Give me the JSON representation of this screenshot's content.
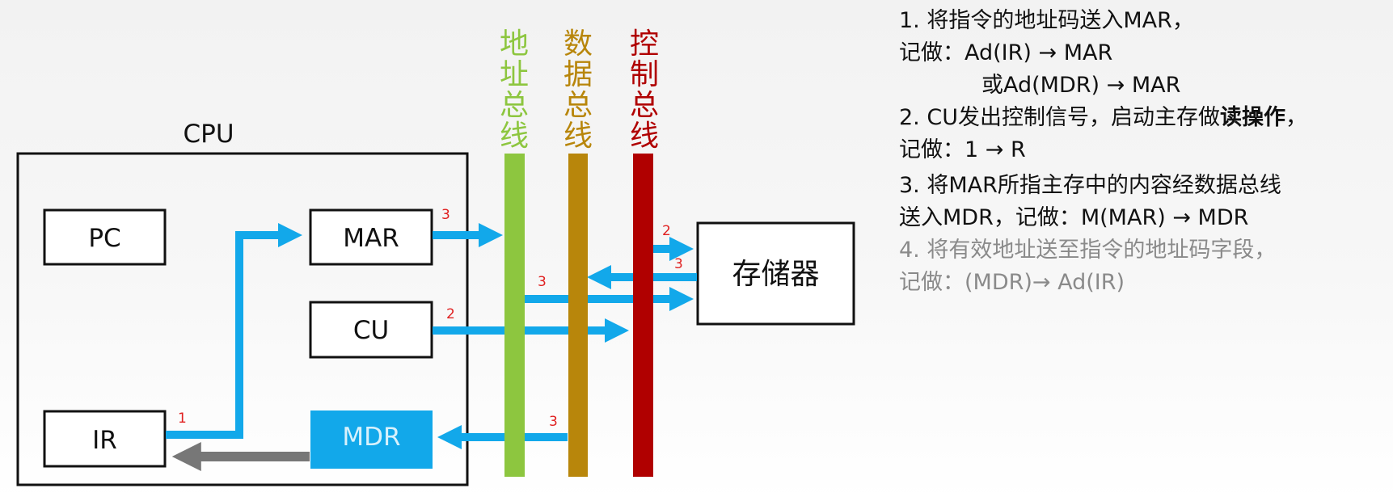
{
  "diagram": {
    "cpu_label": "CPU",
    "registers": {
      "pc": "PC",
      "mar": "MAR",
      "cu": "CU",
      "ir": "IR",
      "mdr": "MDR"
    },
    "memory_label": "存储器",
    "buses": {
      "address": {
        "label": "地址总线",
        "chars": [
          "地",
          "址",
          "总",
          "线"
        ],
        "color": "#8dc63f"
      },
      "data": {
        "label": "数据总线",
        "chars": [
          "数",
          "据",
          "总",
          "线"
        ],
        "color": "#b8860b"
      },
      "control": {
        "label": "控制总线",
        "chars": [
          "控",
          "制",
          "总",
          "线"
        ],
        "color": "#b00000"
      }
    },
    "step_marks": {
      "ir_to_mar": "1",
      "mar_to_addr_bus": "3",
      "ctrl_to_mem": "2",
      "mem_to_data_bus": "3",
      "addr_bus_to_mem": "3",
      "cu_to_ctrl_bus": "2",
      "data_bus_to_mdr": "3"
    },
    "colors": {
      "arrow": "#12a8ea",
      "mdr_fill": "#12a8ea",
      "back_arrow": "#777777",
      "step_mark": "#e02020",
      "muted_text": "#8a8a8a"
    }
  },
  "steps": [
    {
      "lines": [
        {
          "pre": "1. 将指令的地址码送入MAR，",
          "bold": "",
          "post": ""
        },
        {
          "pre": "记做：Ad(IR) → MAR",
          "bold": "",
          "post": ""
        },
        {
          "pre": "或Ad(MDR) → MAR",
          "bold": "",
          "post": ""
        }
      ]
    },
    {
      "lines": [
        {
          "pre": "2. CU发出控制信号，启动主存做",
          "bold": "读操作",
          "post": "，"
        },
        {
          "pre": "记做：1 → R",
          "bold": "",
          "post": ""
        }
      ]
    },
    {
      "lines": [
        {
          "pre": "3. 将MAR所指主存中的内容经数据总线",
          "bold": "",
          "post": ""
        },
        {
          "pre": "送入MDR，记做：M(MAR) → MDR",
          "bold": "",
          "post": ""
        }
      ]
    },
    {
      "lines": [
        {
          "pre": "4. 将有效地址送至指令的地址码字段，",
          "bold": "",
          "post": ""
        },
        {
          "pre": "记做：(MDR)→ Ad(IR)",
          "bold": "",
          "post": ""
        }
      ]
    }
  ]
}
